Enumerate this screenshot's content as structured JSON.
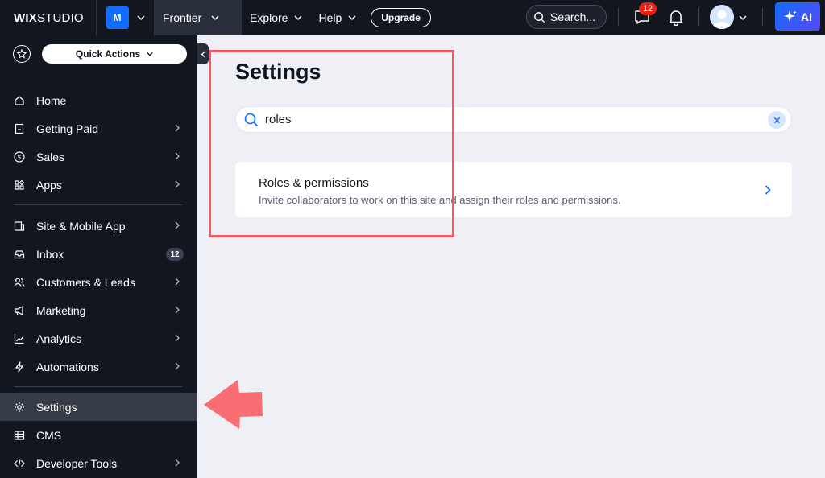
{
  "topbar": {
    "logo_bold": "WIX",
    "logo_light": "STUDIO",
    "site_initial": "M",
    "site_name": "Frontier",
    "nav": [
      "Explore",
      "Help"
    ],
    "upgrade_label": "Upgrade",
    "search_label": "Search...",
    "notifications_count": "12",
    "ai_label": "AI",
    "icons": [
      "chevron-down-icon",
      "search-icon",
      "chat-icon",
      "bell-icon",
      "avatar-icon",
      "sparkle-icon"
    ]
  },
  "sidebar": {
    "quick_actions_label": "Quick Actions",
    "group1": [
      {
        "label": "Home",
        "icon": "home-icon",
        "arrow": false
      },
      {
        "label": "Getting Paid",
        "icon": "invoice-icon",
        "arrow": true
      },
      {
        "label": "Sales",
        "icon": "dollar-icon",
        "arrow": true
      },
      {
        "label": "Apps",
        "icon": "apps-icon",
        "arrow": true
      }
    ],
    "group2": [
      {
        "label": "Site & Mobile App",
        "icon": "layout-icon",
        "arrow": true
      },
      {
        "label": "Inbox",
        "icon": "inbox-icon",
        "badge": "12"
      },
      {
        "label": "Customers & Leads",
        "icon": "people-icon",
        "arrow": true
      },
      {
        "label": "Marketing",
        "icon": "megaphone-icon",
        "arrow": true
      },
      {
        "label": "Analytics",
        "icon": "chart-icon",
        "arrow": true
      },
      {
        "label": "Automations",
        "icon": "lightning-icon",
        "arrow": true
      }
    ],
    "group3": [
      {
        "label": "Settings",
        "icon": "gear-icon",
        "arrow": false,
        "active": true
      },
      {
        "label": "CMS",
        "icon": "table-icon",
        "arrow": false
      },
      {
        "label": "Developer Tools",
        "icon": "code-icon",
        "arrow": true
      }
    ]
  },
  "main": {
    "title": "Settings",
    "search_value": "roles",
    "result": {
      "title": "Roles & permissions",
      "description": "Invite collaborators to work on this site and assign their roles and permissions."
    }
  },
  "colors": {
    "topbar_bg": "#12161f",
    "accent": "#116dff",
    "badge_red": "#e62214",
    "highlight": "#ef5b63",
    "page_bg": "#eff0f6"
  }
}
